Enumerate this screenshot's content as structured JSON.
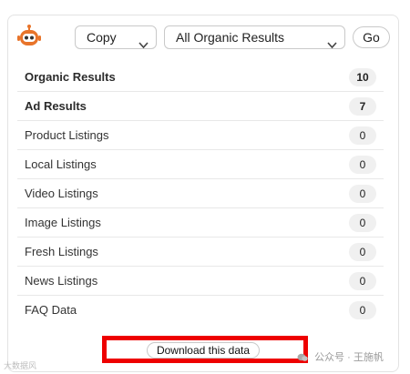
{
  "toolbar": {
    "logo_icon": "robot-logo-icon",
    "copy_select_value": "Copy",
    "results_select_value": "All Organic Results",
    "go_label": "Go",
    "accent_color": "#e8742a"
  },
  "rows": [
    {
      "label": "Organic Results",
      "count": "10",
      "bold": true
    },
    {
      "label": "Ad Results",
      "count": "7",
      "bold": true
    },
    {
      "label": "Product Listings",
      "count": "0",
      "bold": false
    },
    {
      "label": "Local Listings",
      "count": "0",
      "bold": false
    },
    {
      "label": "Video Listings",
      "count": "0",
      "bold": false
    },
    {
      "label": "Image Listings",
      "count": "0",
      "bold": false
    },
    {
      "label": "Fresh Listings",
      "count": "0",
      "bold": false
    },
    {
      "label": "News Listings",
      "count": "0",
      "bold": false
    },
    {
      "label": "FAQ Data",
      "count": "0",
      "bold": false
    }
  ],
  "download_label": "Download this data",
  "highlight_color": "#ee0000",
  "watermarks": {
    "left": "大数据风",
    "right": "公众号 · 王施帆"
  }
}
